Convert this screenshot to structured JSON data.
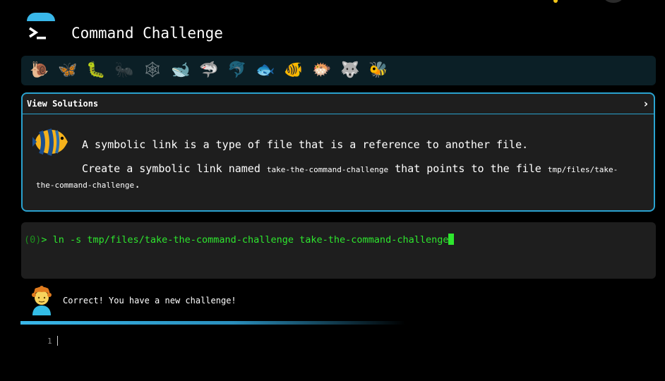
{
  "app": {
    "title": "Command Challenge"
  },
  "animals_bar": {
    "items": [
      {
        "name": "snail",
        "glyph": "🐌",
        "state": "done"
      },
      {
        "name": "butterfly",
        "glyph": "🦋",
        "state": "done"
      },
      {
        "name": "caterpillar",
        "glyph": "🐛",
        "state": "done"
      },
      {
        "name": "ant",
        "glyph": "🐜",
        "state": "dim"
      },
      {
        "name": "spider-web",
        "glyph": "🕸",
        "state": "dim"
      },
      {
        "name": "whale",
        "glyph": "🐋",
        "state": "done"
      },
      {
        "name": "shark",
        "glyph": "🦈",
        "state": "done"
      },
      {
        "name": "dolphin",
        "glyph": "🐬",
        "state": "dim"
      },
      {
        "name": "fish",
        "glyph": "🐟",
        "state": "done"
      },
      {
        "name": "tropical-fish",
        "glyph": "🐠",
        "state": "active"
      },
      {
        "name": "blowfish",
        "glyph": "🐡",
        "state": "done"
      },
      {
        "name": "wolf",
        "glyph": "🐺",
        "state": "done"
      },
      {
        "name": "bee",
        "glyph": "🐝",
        "state": "done"
      }
    ]
  },
  "challenge": {
    "view_solutions_label": "View Solutions",
    "chevron": "›",
    "avatar_icon": "tropical-fish-icon",
    "description_line1": "A symbolic link is a type of file that is a reference to another file.",
    "description_line2_part1": "Create a symbolic link named ",
    "description_line2_code1": "take-the-command-challenge",
    "description_line2_part2": " that points to the file ",
    "description_line2_code2": "tmp/files/take-the-command-challenge",
    "description_line2_end": "."
  },
  "terminal": {
    "prompt_number": "(0)",
    "prompt_symbol": ">",
    "command": " ln -s tmp/files/take-the-command-challenge take-the-command-challenge"
  },
  "result": {
    "avatar_icon": "person-icon",
    "message": "Correct! You have a new challenge!"
  },
  "progress": {
    "fraction": 0.61
  },
  "editor": {
    "line_number": "1"
  },
  "colors": {
    "accent": "#2aa2cf",
    "terminal_green": "#2ee62e",
    "panel_bg": "#1e1e1e",
    "bar_bg": "#0b1f26"
  }
}
